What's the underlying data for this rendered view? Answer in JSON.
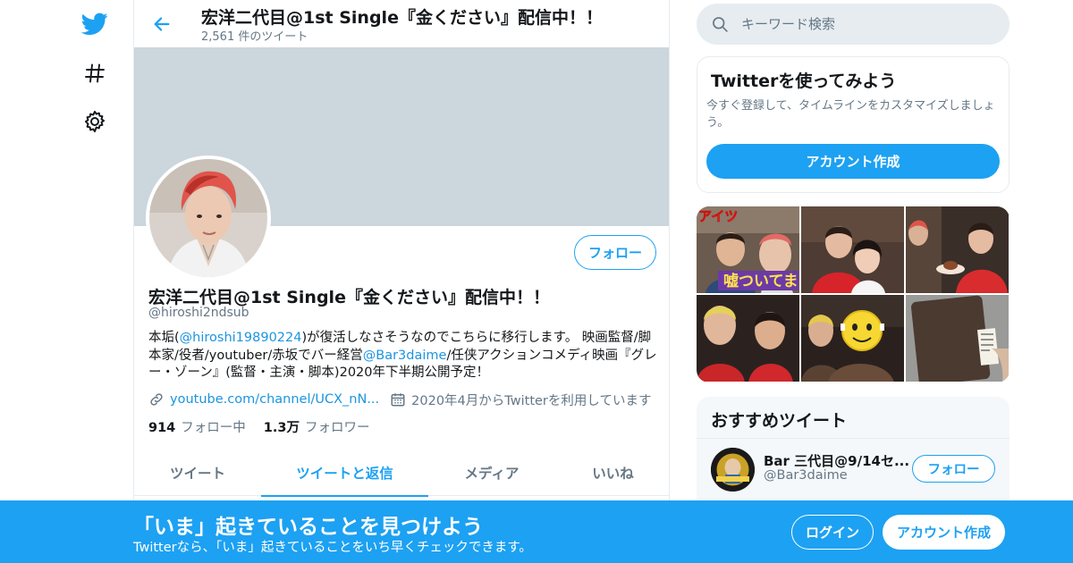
{
  "nav": {
    "icons": [
      "twitter-logo-icon",
      "hashtag-icon",
      "settings-gear-icon"
    ],
    "brand_color": "#1da1f2"
  },
  "header": {
    "name": "宏洋二代目@1st Single『金ください』配信中！！",
    "tweet_count": "2,561 件のツイート"
  },
  "profile": {
    "name": "宏洋二代目@1st Single『金ください』配信中！！",
    "handle": "@hiroshi2ndsub",
    "follow_label": "フォロー",
    "bio": {
      "p1": "本垢(",
      "link1": "@hiroshi19890224",
      "p2": ")が復活しなさそうなのでこちらに移行します。 映画監督/脚本家/役者/youtuber/赤坂でバー経営",
      "link2": "@Bar3daime",
      "p3": "/任侠アクションコメディ映画『グレー・ゾーン』(監督・主演・脚本)2020年下半期公開予定！"
    },
    "url": "youtube.com/channel/UCX_nN...",
    "joined": "2020年4月からTwitterを利用しています",
    "following_count": "914",
    "following_label": "フォロー中",
    "followers_count": "1.3万",
    "followers_label": "フォロワー"
  },
  "tabs": [
    {
      "label": "ツイート",
      "active": false
    },
    {
      "label": "ツイートと返信",
      "active": true
    },
    {
      "label": "メディア",
      "active": false
    },
    {
      "label": "いいね",
      "active": false
    }
  ],
  "search": {
    "placeholder": "キーワード検索"
  },
  "signup_card": {
    "title": "Twitterを使ってみよう",
    "desc": "今すぐ登録して、タイムラインをカスタマイズしましょう。",
    "button": "アカウント作成"
  },
  "media_grid": {
    "caption_text_1": "アイツ",
    "caption_text_2": "嘘ついてま"
  },
  "recommended": {
    "title": "おすすめツイート",
    "account_name": "Bar 三代目@9/14セ...",
    "account_handle": "@Bar3daime",
    "follow_label": "フォロー"
  },
  "bottom_bar": {
    "title": "「いま」起きていることを見つけよう",
    "subtitle": "Twitterなら、「いま」起きていることをいち早くチェックできます。",
    "login": "ログイン",
    "signup": "アカウント作成"
  }
}
